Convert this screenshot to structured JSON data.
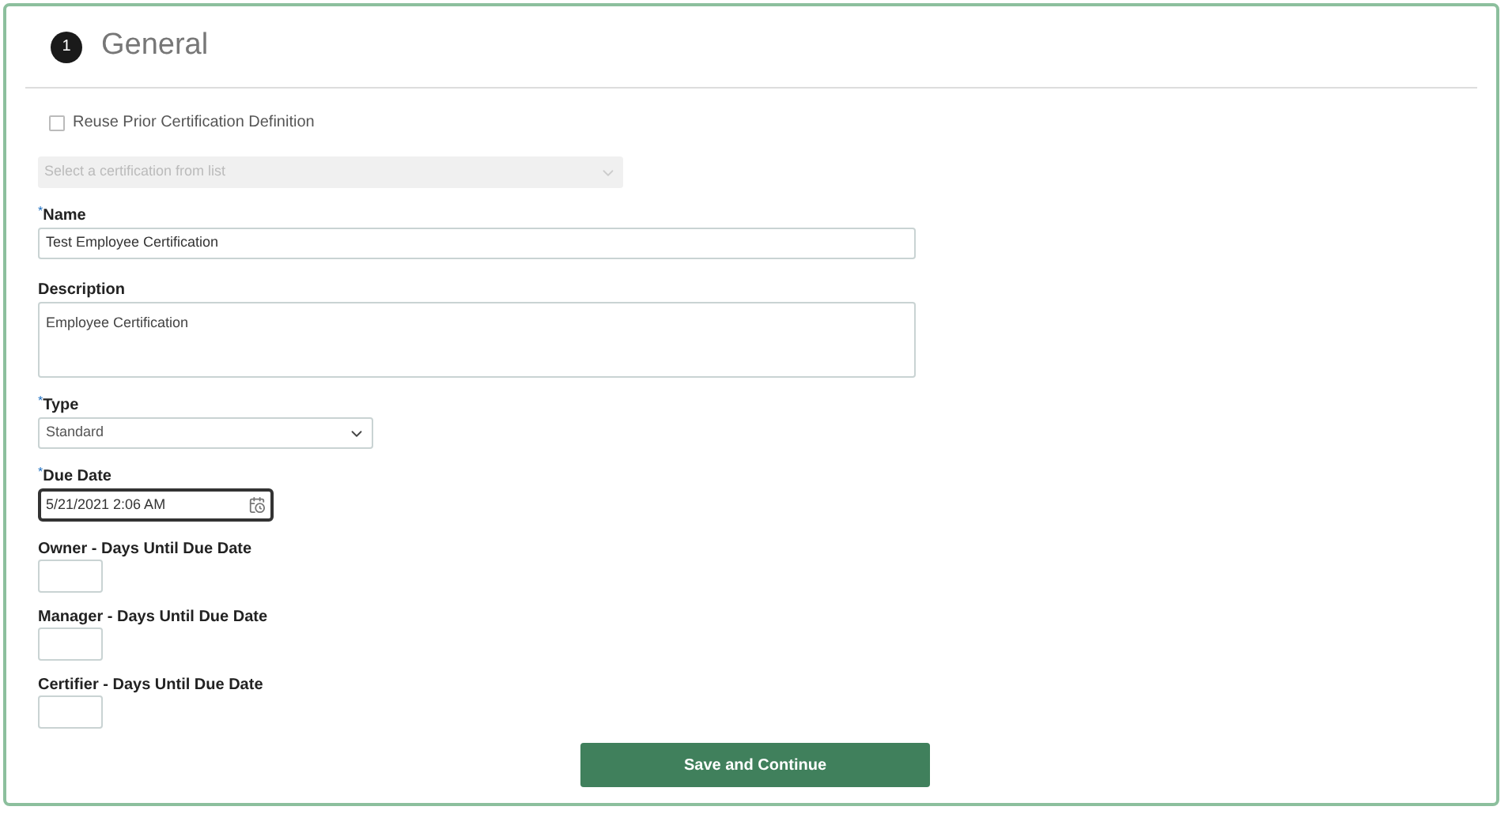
{
  "section": {
    "step": "1",
    "title": "General"
  },
  "fields": [
    {
      "kind": "checkbox",
      "label": "Reuse Prior Certification Definition",
      "checked": false
    },
    {
      "kind": "select",
      "placeholder": "Select a certification from list",
      "disabled": true
    },
    {
      "kind": "text",
      "required_mark": "*",
      "label": "Name",
      "value": "Test Employee Certification"
    },
    {
      "kind": "textarea",
      "label": "Description",
      "value": "Employee Certification"
    },
    {
      "kind": "select",
      "required_mark": "*",
      "label": "Type",
      "value": "Standard",
      "disabled": false
    },
    {
      "kind": "date",
      "required_mark": "*",
      "label": "Due Date",
      "value": "5/21/2021 2:06 AM",
      "focused": true
    },
    {
      "kind": "number",
      "label": "Owner - Days Until Due Date"
    },
    {
      "kind": "number",
      "label": "Manager - Days Until Due Date"
    },
    {
      "kind": "number",
      "label": "Certifier - Days Until Due Date"
    }
  ],
  "save_button": "Save and Continue"
}
